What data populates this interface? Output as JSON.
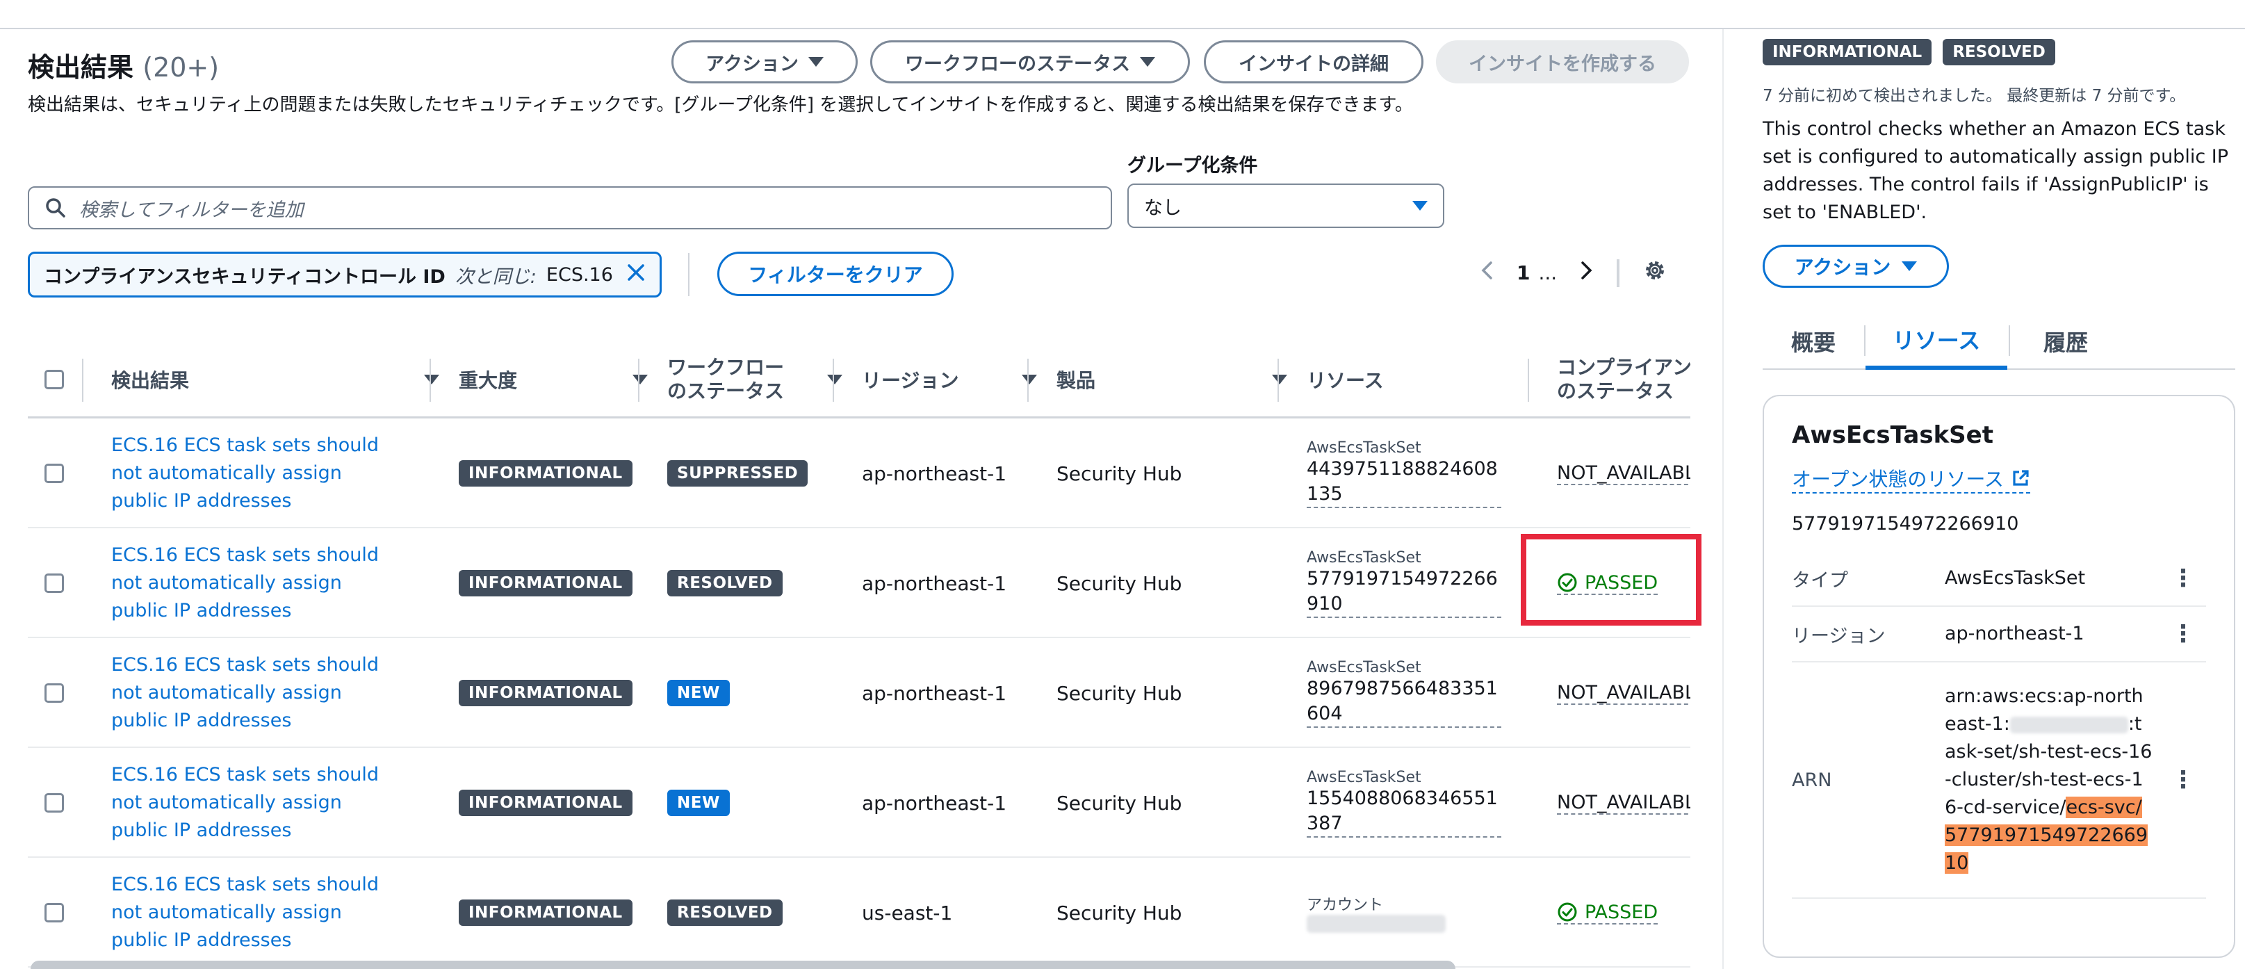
{
  "header": {
    "title": "検出結果",
    "count": "(20+)",
    "description": "検出結果は、セキュリティ上の問題または失敗したセキュリティチェックです。[グループ化条件] を選択してインサイトを作成すると、関連する検出結果を保存できます。",
    "actions_label": "アクション",
    "workflow_status_label": "ワークフローのステータス",
    "insight_details_label": "インサイトの詳細",
    "create_insight_label": "インサイトを作成する"
  },
  "search": {
    "placeholder": "検索してフィルターを追加"
  },
  "group_by": {
    "label": "グループ化条件",
    "value": "なし"
  },
  "filter_token": {
    "key": "コンプライアンスセキュリティコントロール ID",
    "operator": "次と同じ:",
    "value": "ECS.16"
  },
  "clear_filters_label": "フィルターをクリア",
  "pagination": {
    "current": "1",
    "ellipsis": "..."
  },
  "table": {
    "columns": {
      "finding": "検出結果",
      "severity": "重大度",
      "workflow_line1": "ワークフロー",
      "workflow_line2": "のステータス",
      "region": "リージョン",
      "product": "製品",
      "resource": "リソース",
      "compliance_line1": "コンプライアン",
      "compliance_line2": "のステータス"
    },
    "rows": [
      {
        "title": "ECS.16 ECS task sets should not automatically assign public IP addresses",
        "severity": "INFORMATIONAL",
        "workflow": "SUPPRESSED",
        "region": "ap-northeast-1",
        "product": "Security Hub",
        "resource_type": "AwsEcsTaskSet",
        "resource_id": "4439751188824608135",
        "compliance": "NOT_AVAILABL"
      },
      {
        "title": "ECS.16 ECS task sets should not automatically assign public IP addresses",
        "severity": "INFORMATIONAL",
        "workflow": "RESOLVED",
        "region": "ap-northeast-1",
        "product": "Security Hub",
        "resource_type": "AwsEcsTaskSet",
        "resource_id": "5779197154972266910",
        "compliance": "PASSED"
      },
      {
        "title": "ECS.16 ECS task sets should not automatically assign public IP addresses",
        "severity": "INFORMATIONAL",
        "workflow": "NEW",
        "region": "ap-northeast-1",
        "product": "Security Hub",
        "resource_type": "AwsEcsTaskSet",
        "resource_id": "8967987566483351604",
        "compliance": "NOT_AVAILABL"
      },
      {
        "title": "ECS.16 ECS task sets should not automatically assign public IP addresses",
        "severity": "INFORMATIONAL",
        "workflow": "NEW",
        "region": "ap-northeast-1",
        "product": "Security Hub",
        "resource_type": "AwsEcsTaskSet",
        "resource_id": "1554088068346551387",
        "compliance": "NOT_AVAILABL"
      },
      {
        "title": "ECS.16 ECS task sets should not automatically assign public IP addresses",
        "severity": "INFORMATIONAL",
        "workflow": "RESOLVED",
        "region": "us-east-1",
        "product": "Security Hub",
        "resource_type": "アカウント",
        "resource_id": "",
        "compliance": "PASSED"
      }
    ]
  },
  "detail": {
    "severity": "INFORMATIONAL",
    "workflow": "RESOLVED",
    "time_text": "7 分前に初めて検出されました。 最終更新は 7 分前です。",
    "description": "This control checks whether an Amazon ECS task set is configured to automatically assign public IP addresses. The control fails if 'AssignPublicIP' is set to 'ENABLED'.",
    "actions_label": "アクション",
    "tabs": [
      "概要",
      "リソース",
      "履歴"
    ],
    "card": {
      "title": "AwsEcsTaskSet",
      "open_link": "オープン状態のリソース",
      "resource_id": "5779197154972266910",
      "type_label": "タイプ",
      "type_value": "AwsEcsTaskSet",
      "region_label": "リージョン",
      "region_value": "ap-northeast-1",
      "arn_label": "ARN",
      "arn_prefix": "arn:aws:ecs:ap-northeast-1:",
      "arn_mid": ":task-set/sh-test-ecs-16-cluster/sh-test-ecs-16-cd-service/",
      "arn_highlight": "ecs-svc/5779197154972266910"
    }
  },
  "colors": {
    "link": "#0972d3",
    "badge_dark": "#414d5c",
    "badge_new": "#0972d3",
    "passed": "#037f0c",
    "highlight_box": "#e7283d",
    "arn_highlight": "#f89256"
  }
}
